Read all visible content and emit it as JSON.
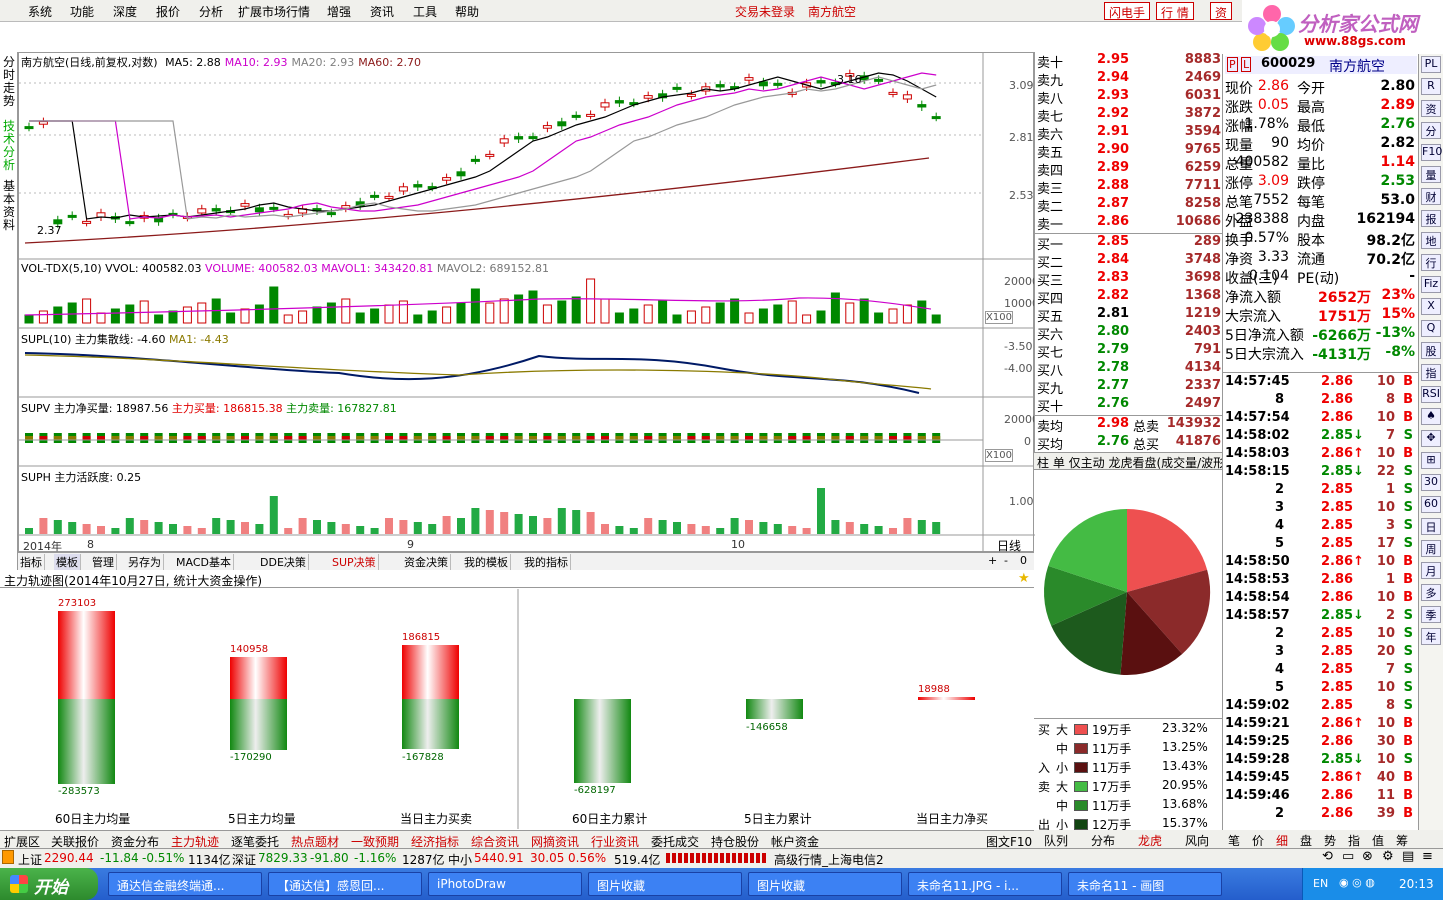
{
  "menu": [
    "系统",
    "功能",
    "深度",
    "报价",
    "分析",
    "扩展市场行情",
    "增强",
    "资讯",
    "工具",
    "帮助"
  ],
  "status_msg": "交易未登录",
  "stock_name_top": "南方航空",
  "top_buttons": [
    "闪电手",
    "行 情",
    "资"
  ],
  "logo": {
    "title": "分析家公式网",
    "url": "www.88gs.com"
  },
  "left_tabs": [
    "分时走势",
    "技术分析",
    "基本资料"
  ],
  "chart": {
    "title": "南方航空(日线,前复权,对数)",
    "ma": [
      {
        "label": "MA5: 2.88",
        "color": "#000000"
      },
      {
        "label": "MA10: 2.93",
        "color": "#cc00cc"
      },
      {
        "label": "MA20: 2.93",
        "color": "#808080"
      },
      {
        "label": "MA60: 2.70",
        "color": "#8b1a1a"
      }
    ],
    "price_axis": [
      "3.09",
      "2.81",
      "2.53"
    ],
    "high_mark": "3.16",
    "low_mark": "2.37",
    "vol_title": "VOL-TDX(5,10) VVOL: 400582.03",
    "vol_extra": "VOLUME: 400582.03",
    "vol_ma1": "MAVOL1: 343420.81",
    "vol_ma2": "MAVOL2: 689152.81",
    "vol_axis": [
      "20000",
      "10000"
    ],
    "x100": "X100",
    "supl_title": "SUPL(10) 主力集散线: -4.60",
    "supl_ma": "MA1: -4.43",
    "supl_axis": [
      "-3.50",
      "-4.00"
    ],
    "supv_title": "SUPV 主力净买量: 18987.56",
    "supv_buy": "主力买量: 186815.38",
    "supv_sell": "主力卖量: 167827.81",
    "supv_axis": [
      "20000",
      "0"
    ],
    "suph_title": "SUPH 主力活跃度: 0.25",
    "suph_axis": [
      "1.00"
    ],
    "date_labels": [
      "2014年",
      "8",
      "9",
      "10"
    ],
    "period": "日线",
    "zoom_btns": [
      "+",
      "-",
      "0"
    ]
  },
  "toolbar_tabs": [
    "指标",
    "模板",
    "管理",
    "另存为",
    "MACD基本",
    "DDE决策",
    "SUP决策",
    "资金决策",
    "我的模板",
    "我的指标"
  ],
  "track_title": "主力轨迹图(2014年10月27日, 统计大资金操作)",
  "track_bars": [
    {
      "caption": "60日主力均量",
      "up": "273103",
      "down": "-283573"
    },
    {
      "caption": "5日主力均量",
      "up": "140958",
      "down": "-170290"
    },
    {
      "caption": "当日主力买卖",
      "up": "186815",
      "down": "-167828"
    },
    {
      "caption": "60日主力累计",
      "up": "",
      "down": "-628197"
    },
    {
      "caption": "5日主力累计",
      "up": "",
      "down": "-146658"
    },
    {
      "caption": "当日主力净买",
      "up": "18988",
      "down": ""
    }
  ],
  "bottom_tabs": [
    "扩展区",
    "关联报价",
    "资金分布",
    "主力轨迹",
    "逐笔委托",
    "热点题材",
    "一致预期",
    "经济指标",
    "综合资讯",
    "网摘资讯",
    "行业资讯",
    "委托成交",
    "持仓股份",
    "帐户资金"
  ],
  "bottom_right": "图文F10",
  "orderbook": {
    "sells": [
      {
        "n": "卖十",
        "p": "2.95",
        "v": "8883"
      },
      {
        "n": "卖九",
        "p": "2.94",
        "v": "2469"
      },
      {
        "n": "卖八",
        "p": "2.93",
        "v": "6031"
      },
      {
        "n": "卖七",
        "p": "2.92",
        "v": "3872"
      },
      {
        "n": "卖六",
        "p": "2.91",
        "v": "3594"
      },
      {
        "n": "卖五",
        "p": "2.90",
        "v": "9765"
      },
      {
        "n": "卖四",
        "p": "2.89",
        "v": "6259"
      },
      {
        "n": "卖三",
        "p": "2.88",
        "v": "7711"
      },
      {
        "n": "卖二",
        "p": "2.87",
        "v": "8258"
      },
      {
        "n": "卖一",
        "p": "2.86",
        "v": "10686"
      }
    ],
    "buys": [
      {
        "n": "买一",
        "p": "2.85",
        "v": "289"
      },
      {
        "n": "买二",
        "p": "2.84",
        "v": "3748"
      },
      {
        "n": "买三",
        "p": "2.83",
        "v": "3698"
      },
      {
        "n": "买四",
        "p": "2.82",
        "v": "1368"
      },
      {
        "n": "买五",
        "p": "2.81",
        "v": "1219"
      },
      {
        "n": "买六",
        "p": "2.80",
        "v": "2403"
      },
      {
        "n": "买七",
        "p": "2.79",
        "v": "791"
      },
      {
        "n": "买八",
        "p": "2.78",
        "v": "4134"
      },
      {
        "n": "买九",
        "p": "2.77",
        "v": "2337"
      },
      {
        "n": "买十",
        "p": "2.76",
        "v": "2497"
      }
    ],
    "sell_avg": {
      "label": "卖均",
      "p": "2.98",
      "tl": "总卖",
      "tv": "143932"
    },
    "buy_avg": {
      "label": "买均",
      "p": "2.76",
      "tl": "总买",
      "tv": "41876"
    }
  },
  "pie_tabs": "柱 单 仅主动 龙虎看盘(成交量/波形)",
  "pie_rows": [
    {
      "side": "买",
      "size": "大",
      "amt": "19万手",
      "pct": "23.32%",
      "color": "#ee5050"
    },
    {
      "side": "",
      "size": "中",
      "amt": "11万手",
      "pct": "13.25%",
      "color": "#8b2a2a"
    },
    {
      "side": "入",
      "size": "小",
      "amt": "11万手",
      "pct": "13.43%",
      "color": "#5a1010"
    },
    {
      "side": "卖",
      "size": "大",
      "amt": "17万手",
      "pct": "20.95%",
      "color": "#44bb44"
    },
    {
      "side": "",
      "size": "中",
      "amt": "11万手",
      "pct": "13.68%",
      "color": "#2a8a2a"
    },
    {
      "side": "出",
      "size": "小",
      "amt": "12万手",
      "pct": "15.37%",
      "color": "#114411"
    }
  ],
  "right_tabs": [
    "队列",
    "分布",
    "龙虎",
    "风向"
  ],
  "quote": {
    "code": "600029",
    "name": "南方航空",
    "rows": [
      [
        "现价",
        "2.86",
        "今开",
        "2.80"
      ],
      [
        "涨跌",
        "0.05",
        "最高",
        "2.89"
      ],
      [
        "涨幅",
        "1.78%",
        "最低",
        "2.76"
      ],
      [
        "现量",
        "90",
        "均价",
        "2.82"
      ],
      [
        "总量",
        "400582",
        "量比",
        "1.14"
      ],
      [
        "涨停",
        "3.09",
        "跌停",
        "2.53"
      ],
      [
        "总笔",
        "7552",
        "每笔",
        "53.0"
      ],
      [
        "外盘",
        "238388",
        "内盘",
        "162194"
      ],
      [
        "换手",
        "0.57%",
        "股本",
        "98.2亿"
      ],
      [
        "净资",
        "3.33",
        "流通",
        "70.2亿"
      ],
      [
        "收益(三)",
        "-0.104",
        "PE(动)",
        "-"
      ]
    ],
    "flows": [
      [
        "净流入额",
        "2652万",
        "23%"
      ],
      [
        "大宗流入",
        "1751万",
        "15%"
      ],
      [
        "5日净流入额",
        "-6266万",
        "-13%"
      ],
      [
        "5日大宗流入",
        "-4131万",
        "-8%"
      ]
    ]
  },
  "ticks": [
    [
      "14:57:45",
      "2.86",
      "10",
      "B"
    ],
    [
      "8",
      "2.86",
      "8",
      "B"
    ],
    [
      "14:57:54",
      "2.86",
      "10",
      "B"
    ],
    [
      "14:58:02",
      "2.85↓",
      "7",
      "S"
    ],
    [
      "14:58:03",
      "2.86↑",
      "10",
      "B"
    ],
    [
      "14:58:15",
      "2.85↓",
      "22",
      "S"
    ],
    [
      "2",
      "2.85",
      "1",
      "S"
    ],
    [
      "3",
      "2.85",
      "10",
      "S"
    ],
    [
      "4",
      "2.85",
      "3",
      "S"
    ],
    [
      "5",
      "2.85",
      "17",
      "S"
    ],
    [
      "14:58:50",
      "2.86↑",
      "10",
      "B"
    ],
    [
      "14:58:53",
      "2.86",
      "1",
      "B"
    ],
    [
      "14:58:54",
      "2.86",
      "10",
      "B"
    ],
    [
      "14:58:57",
      "2.85↓",
      "2",
      "S"
    ],
    [
      "2",
      "2.85",
      "10",
      "S"
    ],
    [
      "3",
      "2.85",
      "20",
      "S"
    ],
    [
      "4",
      "2.85",
      "7",
      "S"
    ],
    [
      "5",
      "2.85",
      "10",
      "S"
    ],
    [
      "14:59:02",
      "2.85",
      "8",
      "S"
    ],
    [
      "14:59:21",
      "2.86↑",
      "10",
      "B"
    ],
    [
      "14:59:25",
      "2.86",
      "30",
      "B"
    ],
    [
      "14:59:28",
      "2.85↓",
      "10",
      "S"
    ],
    [
      "14:59:45",
      "2.86↑",
      "40",
      "B"
    ],
    [
      "14:59:46",
      "2.86",
      "11",
      "B"
    ],
    [
      "2",
      "2.86",
      "39",
      "B"
    ]
  ],
  "side_icons": [
    "PL",
    "R",
    "资",
    "分",
    "F10",
    "量",
    "财",
    "报",
    "地",
    "行",
    "Fiz",
    "X",
    "Q",
    "股",
    "指",
    "RSI",
    "♠",
    "✥",
    "⊞",
    "30",
    "60",
    "日",
    "周",
    "月",
    "多",
    "季",
    "年"
  ],
  "tick_tabs": [
    "笔",
    "价",
    "细",
    "盘",
    "势",
    "指",
    "值",
    "筹"
  ],
  "statusbar": {
    "sh_label": "上证",
    "sh_val": "2290.44",
    "sh_chg": "-11.84",
    "sh_pct": "-0.51%",
    "sh_amt": "1134亿",
    "sz_label": "深证",
    "sz_val": "7829.33",
    "sz_chg": "-91.80",
    "sz_pct": "-1.16%",
    "sz_amt": "1287亿",
    "zx_label": "中小",
    "zx_val": "5440.91",
    "zx_chg": "30.05",
    "zx_pct": "0.56%",
    "zx_amt": "519.4亿",
    "server": "高级行情_上海电信2"
  },
  "taskbar": {
    "start": "开始",
    "tasks": [
      "通达信金融终端通...",
      "【通达信】感恩回...",
      "iPhotoDraw",
      "图片收藏",
      "图片收藏",
      "未命名11.JPG - i...",
      "未命名11 - 画图"
    ],
    "lang": "EN",
    "clock": "20:13"
  }
}
